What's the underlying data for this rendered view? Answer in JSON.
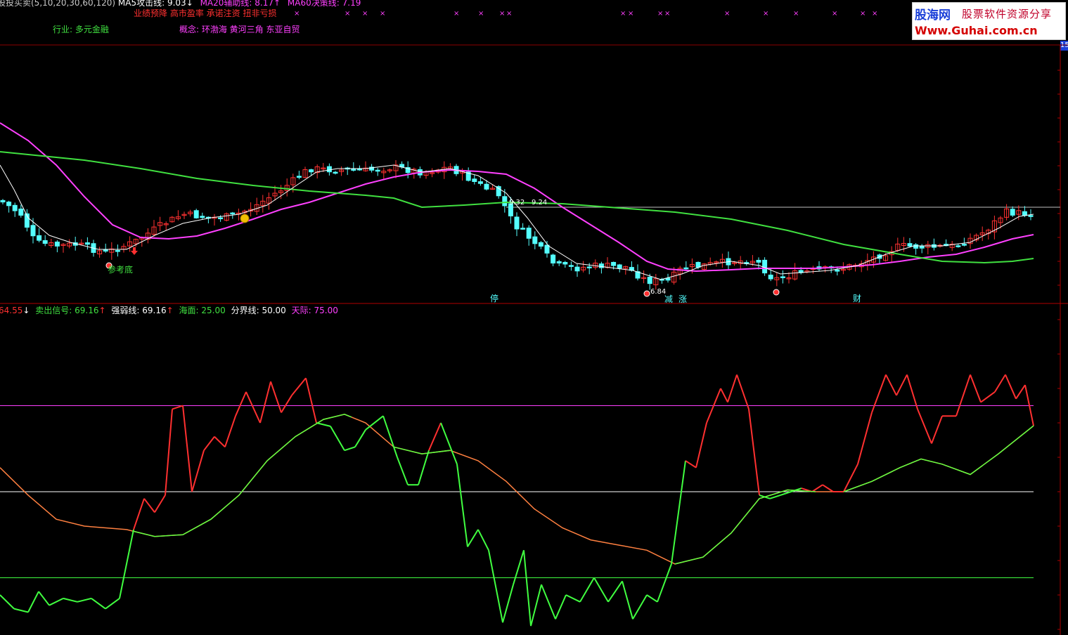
{
  "main_header": {
    "line1_prefix": "股投买卖(5,10,20,30,60,120)",
    "ma5_label": "MA5攻击线:",
    "ma5_value": "9.03",
    "ma20_label": "MA20辅助线:",
    "ma20_value": "8.17",
    "ma60_label": "MA60决策线:",
    "ma60_value": "7.19"
  },
  "info": {
    "performance": "业绩预降 高市盈率 承诺注资 扭非亏损",
    "industry": "行业: 多元金融",
    "concept": "概念: 环渤海 黄河三角 东亚自贸"
  },
  "watermark": {
    "site_name": "股海网",
    "slogan": "股票软件资源分享",
    "url": "Www.Guhai.com.cn"
  },
  "axis": {
    "right_top_label": "15"
  },
  "price_chart": {
    "bottom_annotation": "参考底",
    "labels": [
      "9.32",
      "9.24",
      "6.84"
    ],
    "event_markers": [
      "停",
      "减",
      "涨",
      "财"
    ],
    "colors": {
      "up": "#ff3232",
      "down": "#54ffff",
      "ma5": "#ffffff",
      "ma20": "#ff40ff",
      "ma60": "#40e040"
    }
  },
  "indicator_header": {
    "first_value": "64.55",
    "sell_label": "卖出信号:",
    "sell_value": "69.16",
    "strength_label": "强弱线:",
    "strength_value": "69.16",
    "sea_label": "海面:",
    "sea_value": "25.00",
    "divider_label": "分界线:",
    "divider_value": "50.00",
    "sky_label": "天际:",
    "sky_value": "75.00"
  },
  "chart_data": {
    "type": "line",
    "series": [
      {
        "name": "卖出信号",
        "color": "#ff3030",
        "last": 69.16
      },
      {
        "name": "强弱线",
        "color": "#40ff40",
        "last": 69.16
      },
      {
        "name": "海面",
        "color": "#40ff40",
        "level": 25.0
      },
      {
        "name": "分界线",
        "color": "#ffffff",
        "level": 50.0
      },
      {
        "name": "天际",
        "color": "#ff40ff",
        "level": 75.0
      }
    ]
  }
}
